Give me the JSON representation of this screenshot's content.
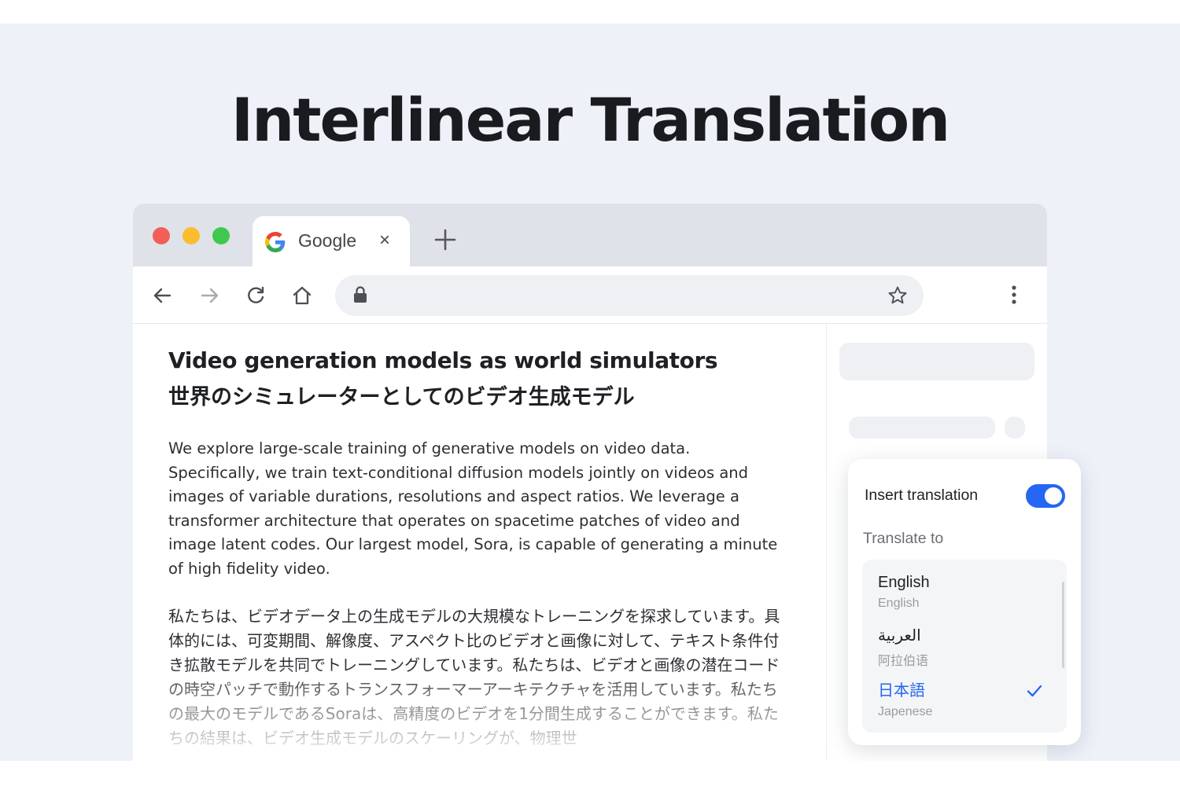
{
  "headline": "Interlinear Translation",
  "browser": {
    "tab": {
      "title": "Google",
      "favicon": "google-g-icon",
      "close_icon": "×"
    },
    "toolbar": {
      "icons": [
        "back-arrow-icon",
        "forward-arrow-icon",
        "reload-icon",
        "home-icon",
        "lock-icon",
        "bookmark-star-icon",
        "kebab-menu-icon"
      ]
    }
  },
  "article": {
    "title_en": "Video generation models as world simulators",
    "title_ja": "世界のシミュレーターとしてのビデオ生成モデル",
    "body_en": "We explore large-scale training of generative models on video data. Specifically, we train text-conditional diffusion models jointly on videos and images of variable durations, resolutions and aspect ratios. We leverage a transformer architecture that operates on spacetime patches of video and image latent codes. Our largest model, Sora, is capable of generating a minute of high fidelity video.",
    "body_ja": "私たちは、ビデオデータ上の生成モデルの大規模なトレーニングを探求しています。具体的には、可変期間、解像度、アスペクト比のビデオと画像に対して、テキスト条件付き拡散モデルを共同でトレーニングしています。私たちは、ビデオと画像の潜在コードの時空パッチで動作するトランスフォーマーアーキテクチャを活用しています。私たちの最大のモデルであるSoraは、高精度のビデオを1分間生成することができます。私たちの結果は、ビデオ生成モデルのスケーリングが、物理世"
  },
  "popup": {
    "insert_label": "Insert translation",
    "insert_enabled": true,
    "translate_to_label": "Translate to",
    "languages": [
      {
        "native": "English",
        "sub": "English",
        "selected": false
      },
      {
        "native": "العربية",
        "sub": "阿拉伯语",
        "selected": false
      },
      {
        "native": "日本語",
        "sub": "Japenese",
        "selected": true
      }
    ],
    "accent": "#2566f2"
  }
}
